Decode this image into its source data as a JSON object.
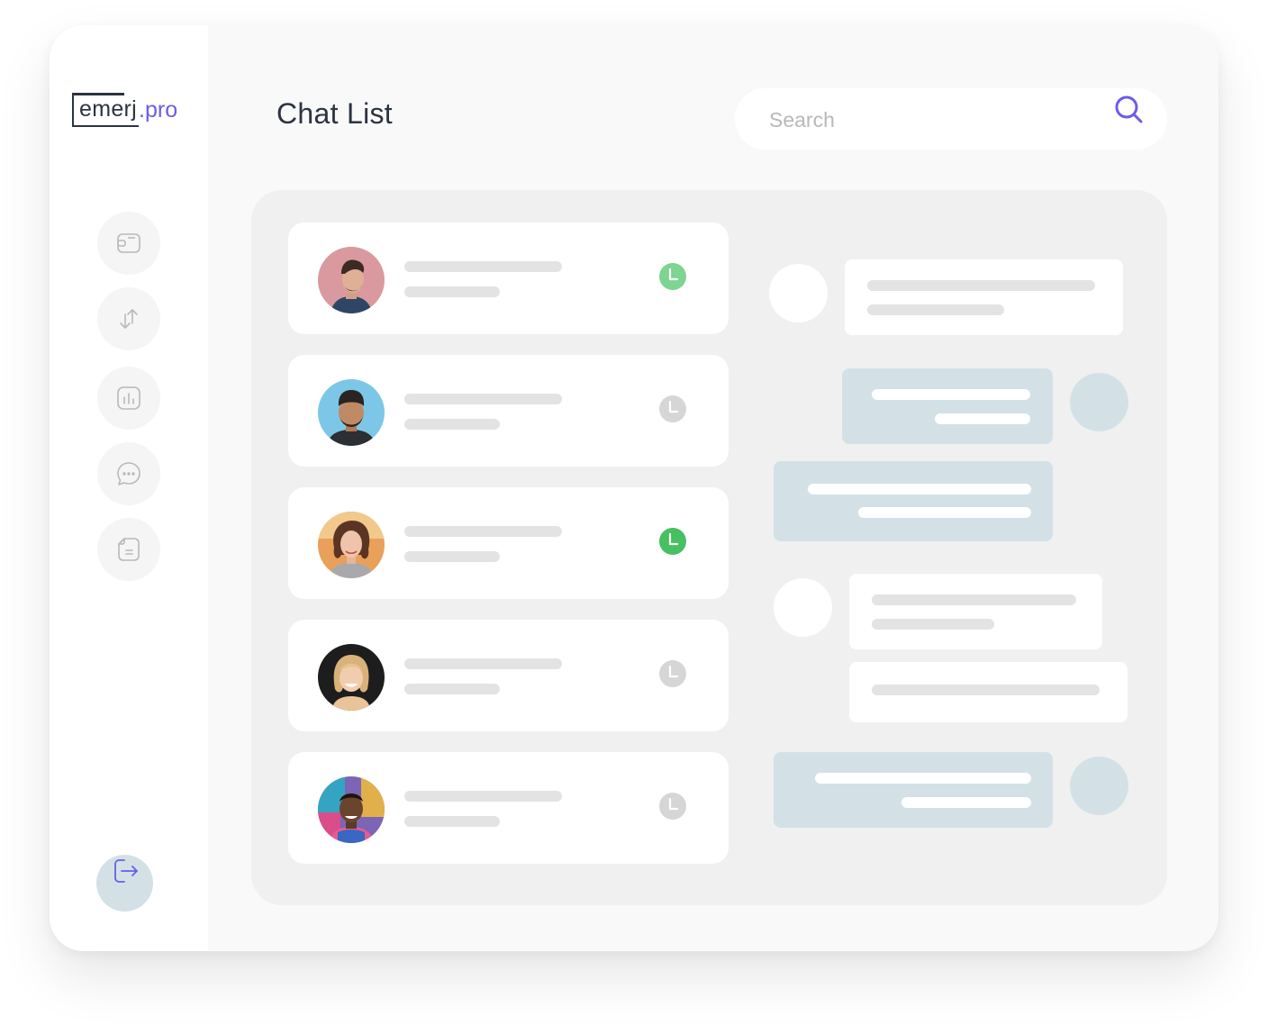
{
  "brand": {
    "name": "emerj",
    "dot": ".",
    "suffix": "pro"
  },
  "header": {
    "title": "Chat List"
  },
  "search": {
    "placeholder": "Search"
  },
  "nav": {
    "items": [
      {
        "name": "wallet",
        "icon": "wallet-icon"
      },
      {
        "name": "transfers",
        "icon": "arrows-up-down-icon"
      },
      {
        "name": "analytics",
        "icon": "bar-chart-icon"
      },
      {
        "name": "chat",
        "icon": "chat-bubble-icon"
      },
      {
        "name": "documents",
        "icon": "document-icon"
      }
    ],
    "logout": {
      "icon": "logout-icon"
    }
  },
  "chats": [
    {
      "avatar": "avatar-man-pink-background",
      "status": "online",
      "status_color": "#7ed491"
    },
    {
      "avatar": "avatar-man-blue-background",
      "status": "away",
      "status_color": "#d6d6d6"
    },
    {
      "avatar": "avatar-woman-curly-hair",
      "status": "online",
      "status_color": "#46c060"
    },
    {
      "avatar": "avatar-woman-blonde",
      "status": "away",
      "status_color": "#d6d6d6"
    },
    {
      "avatar": "avatar-man-colorful-background",
      "status": "away",
      "status_color": "#d6d6d6"
    }
  ],
  "colors": {
    "accent": "#6c5ce7",
    "bubble_blue": "#d3e1e7",
    "placeholder_bar": "#e3e3e3",
    "panel": "#f0f0f0",
    "text_dark": "#2c3440"
  }
}
